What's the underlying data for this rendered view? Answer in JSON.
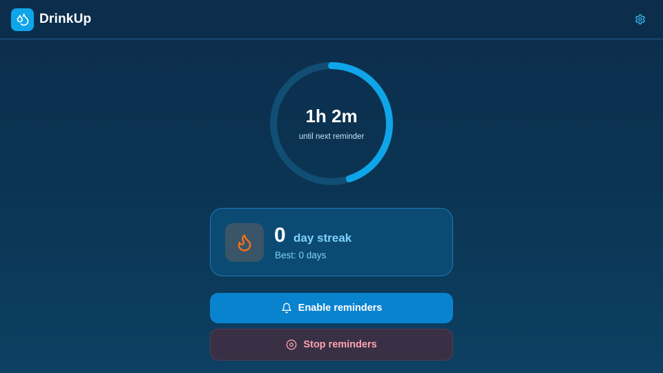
{
  "app": {
    "title": "DrinkUp",
    "accent_color": "#0ea5e9",
    "logo_icon": "water-drops-icon"
  },
  "header": {
    "settings_icon": "gear-icon"
  },
  "timer": {
    "value": "1h 2m",
    "caption": "until next reminder",
    "progress": 0.45,
    "track_color": "#124e74",
    "progress_color": "#0ea5e9"
  },
  "streak": {
    "count": "0",
    "label": "day streak",
    "best": "Best: 0 days",
    "icon": "flame-icon",
    "icon_color": "#f97316"
  },
  "actions": {
    "enable_label": "Enable reminders",
    "enable_icon": "bell-icon",
    "stop_label": "Stop reminders",
    "stop_icon": "stop-circle-icon",
    "stop_color": "#fda4af"
  }
}
